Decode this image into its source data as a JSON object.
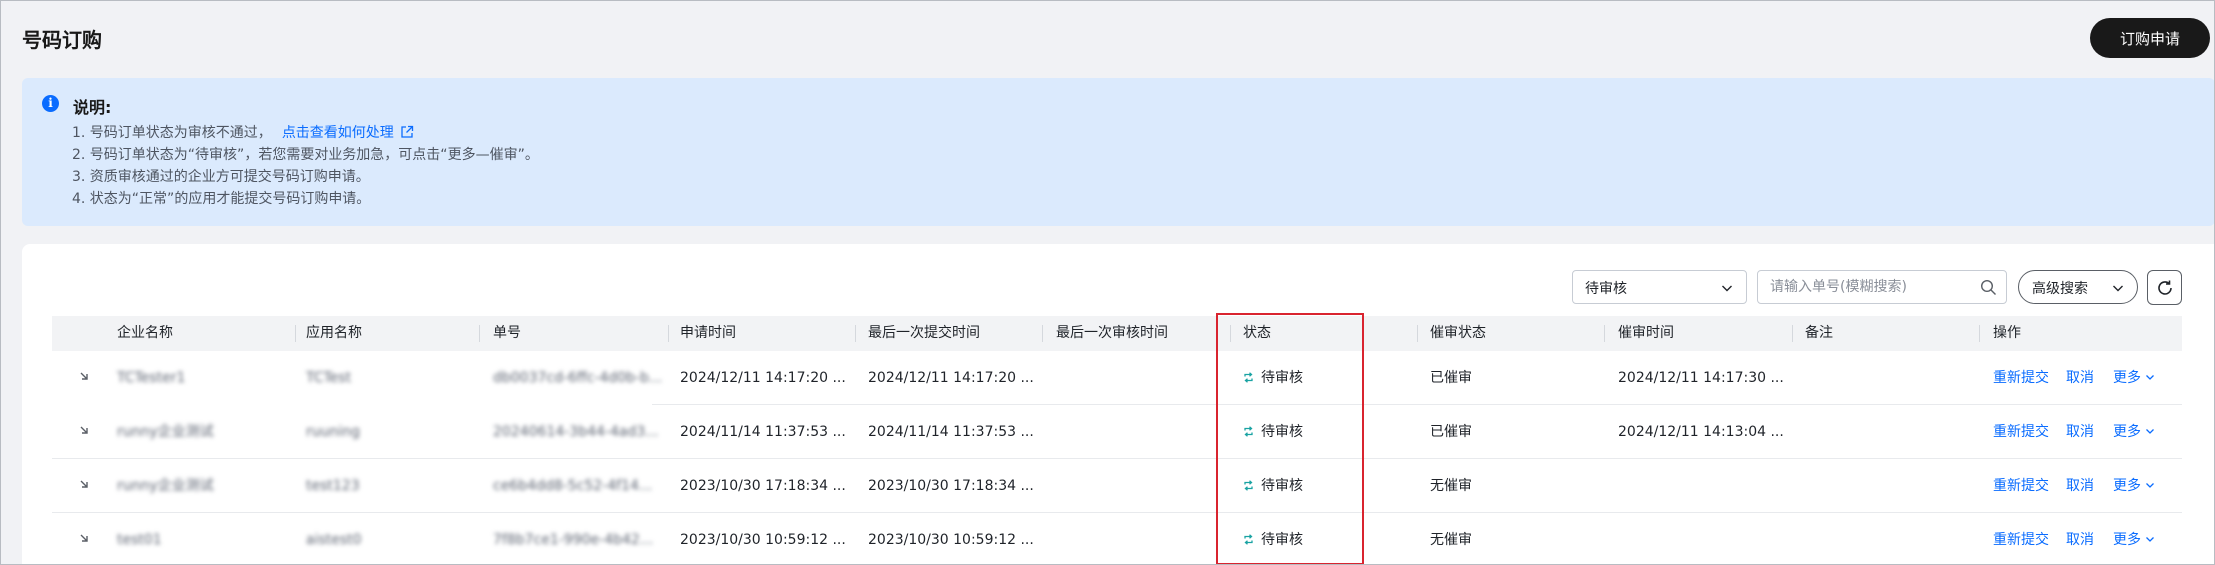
{
  "page": {
    "title": "号码订购"
  },
  "header": {
    "apply_button": "订购申请"
  },
  "notice": {
    "icon": "info-icon",
    "title": "说明:",
    "lines": [
      "1. 号码订单状态为审核不通过，",
      "2. 号码订单状态为“待审核”，若您需要对业务加急，可点击“更多—催审”。",
      "3. 资质审核通过的企业方可提交号码订购申请。",
      "4. 状态为“正常”的应用才能提交号码订购申请。"
    ],
    "link": "点击查看如何处理"
  },
  "toolbar": {
    "status_filter": "待审核",
    "search_placeholder": "请输入单号(模糊搜索)",
    "advanced_search": "高级搜索"
  },
  "table": {
    "columns": [
      "企业名称",
      "应用名称",
      "单号",
      "申请时间",
      "最后一次提交时间",
      "最后一次审核时间",
      "状态",
      "催审状态",
      "催审时间",
      "备注",
      "操作"
    ],
    "rows": [
      {
        "company": "TCTester1",
        "app": "TCTest",
        "order_no": "db0037cd-6ffc-4d0b-b...",
        "apply_time": "2024/12/11 14:17:20 ...",
        "last_submit": "2024/12/11 14:17:20 ...",
        "last_review": "",
        "status": "待审核",
        "urge_status": "已催审",
        "urge_time": "2024/12/11 14:17:30 ...",
        "remark": ""
      },
      {
        "company": "runny企业测试",
        "app": "ruuning",
        "order_no": "20240614-3b44-4ad3...",
        "apply_time": "2024/11/14 11:37:53 ...",
        "last_submit": "2024/11/14 11:37:53 ...",
        "last_review": "",
        "status": "待审核",
        "urge_status": "已催审",
        "urge_time": "2024/12/11 14:13:04 ...",
        "remark": ""
      },
      {
        "company": "runny企业测试",
        "app": "test123",
        "order_no": "ce6b4dd8-5c52-4f14...",
        "apply_time": "2023/10/30 17:18:34 ...",
        "last_submit": "2023/10/30 17:18:34 ...",
        "last_review": "",
        "status": "待审核",
        "urge_status": "无催审",
        "urge_time": "",
        "remark": ""
      },
      {
        "company": "test01",
        "app": "aistest0",
        "order_no": "7f8b7ce1-990e-4b42...",
        "apply_time": "2023/10/30 10:59:12 ...",
        "last_submit": "2023/10/30 10:59:12 ...",
        "last_review": "",
        "status": "待审核",
        "urge_status": "无催审",
        "urge_time": "",
        "remark": ""
      }
    ],
    "actions": {
      "resubmit": "重新提交",
      "cancel": "取消",
      "more": "更多"
    }
  },
  "colors": {
    "accent": "#0a6cff",
    "status_pending": "#1aa3a3",
    "highlight": "#d9242f",
    "notice_bg": "#dbeafd"
  }
}
